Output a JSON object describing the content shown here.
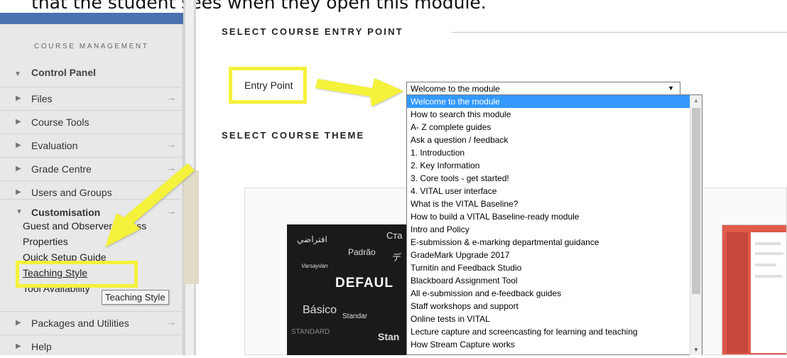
{
  "instruction": "that the student sees when they open this module.",
  "sidebar": {
    "heading": "COURSE MANAGEMENT",
    "control_panel": "Control Panel",
    "items": [
      {
        "label": "Files",
        "arrow": "→"
      },
      {
        "label": "Course Tools",
        "arrow": ""
      },
      {
        "label": "Evaluation",
        "arrow": "→"
      },
      {
        "label": "Grade Centre",
        "arrow": "→"
      },
      {
        "label": "Users and Groups",
        "arrow": ""
      },
      {
        "label": "Customisation",
        "arrow": "→"
      }
    ],
    "sub_items": [
      "Guest and Observer Access",
      "Properties",
      "Quick Setup Guide",
      "Teaching Style",
      "Tool Availability"
    ],
    "bottom_items": [
      {
        "label": "Packages and Utilities",
        "arrow": "→"
      },
      {
        "label": "Help",
        "arrow": ""
      }
    ],
    "tooltip": "Teaching Style"
  },
  "main": {
    "entry_section_title": "SELECT COURSE ENTRY POINT",
    "entry_label": "Entry Point",
    "select_value": "Welcome to the module",
    "theme_section_title": "SELECT COURSE THEME",
    "options": [
      "Welcome to the module",
      "How to search this module",
      "A- Z complete guides",
      "Ask a question / feedback",
      "1. Introduction",
      "2. Key Information",
      "3. Core tools - get started!",
      "4. VITAL user interface",
      "What is the VITAL Baseline?",
      "How to build a VITAL Baseline-ready module",
      "Intro and Policy",
      "E-submission & e-marking departmental guidance",
      "GradeMark Upgrade 2017",
      "Turnitin and Feedback Studio",
      "Blackboard Assignment Tool",
      "All e-submission and e-feedback guides",
      "Staff workshops and support",
      "Online tests in VITAL",
      "Lecture capture and screencasting for learning and teaching",
      "How Stream Capture works"
    ],
    "selected_index": 0,
    "theme_thumb_words": [
      "افتراضي",
      "Ста",
      "Padrão",
      "デ",
      "Varsayılan",
      "DEFAUL",
      "Básico",
      "Standar",
      "STANDARD",
      "Stan"
    ]
  },
  "colors": {
    "highlight": "#f4f23a",
    "selection": "#3399ff",
    "sidebar_bg": "#e8e8e8"
  }
}
